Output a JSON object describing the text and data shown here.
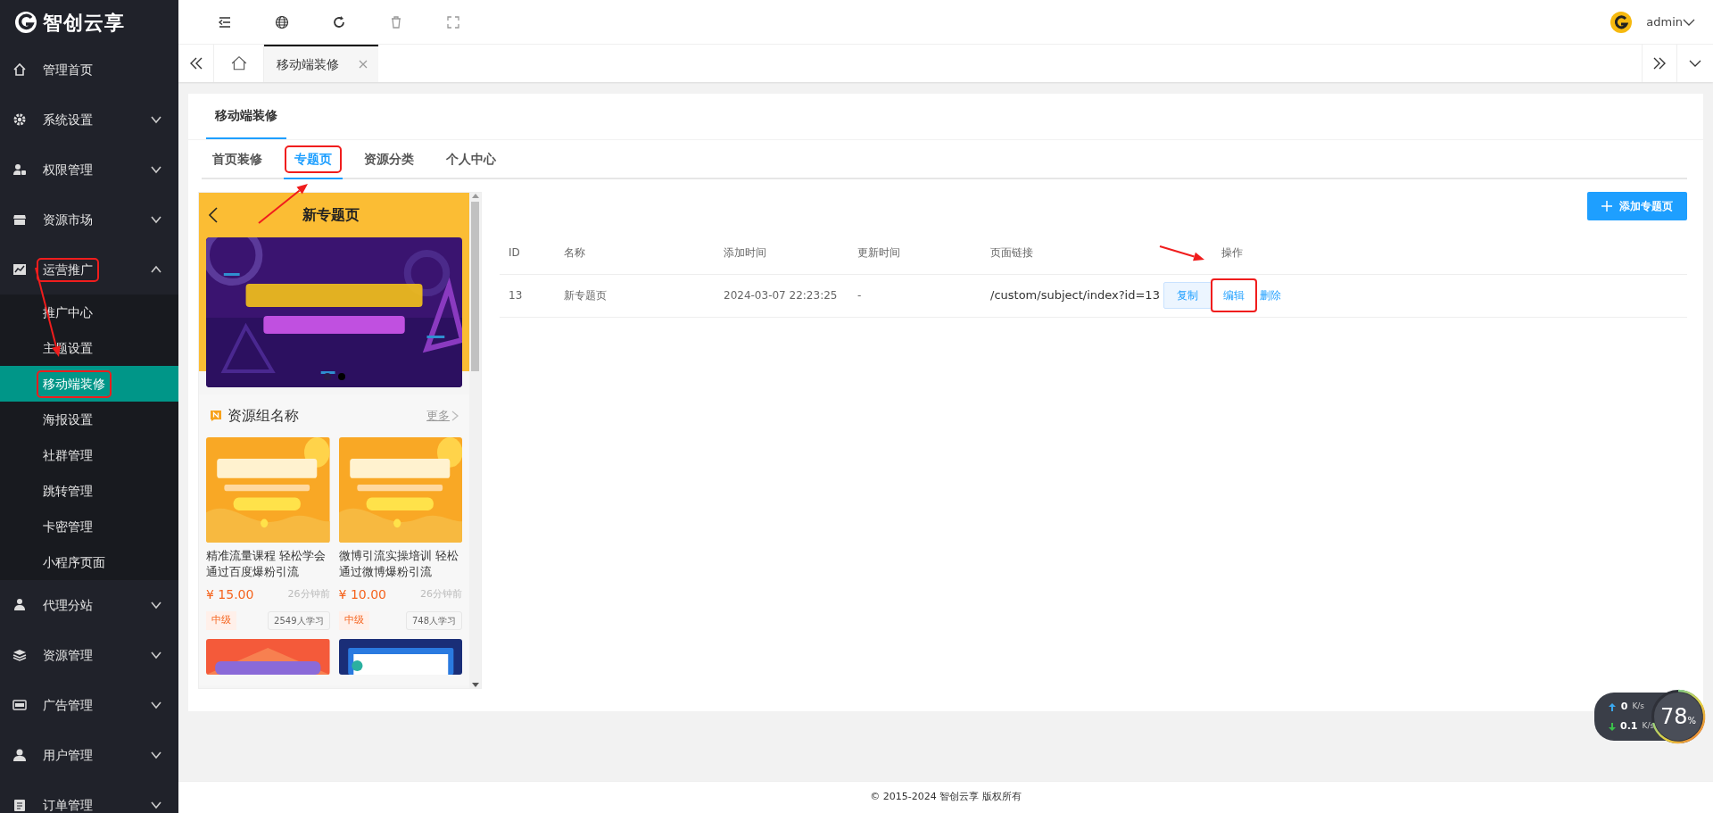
{
  "sidebar": {
    "logo": "智创云享",
    "items": [
      {
        "label": "管理首页",
        "highlighted": false
      },
      {
        "label": "系统设置",
        "expanded": false,
        "highlighted": false
      },
      {
        "label": "权限管理",
        "expanded": false,
        "highlighted": false
      },
      {
        "label": "资源市场",
        "expanded": false,
        "highlighted": false
      },
      {
        "label": "运营推广",
        "expanded": true,
        "highlighted": true,
        "children": [
          {
            "label": "推广中心",
            "selected": false,
            "highlighted": false
          },
          {
            "label": "主题设置",
            "selected": false,
            "highlighted": false
          },
          {
            "label": "移动端装修",
            "selected": true,
            "highlighted": true
          },
          {
            "label": "海报设置",
            "selected": false,
            "highlighted": false
          },
          {
            "label": "社群管理",
            "selected": false,
            "highlighted": false
          },
          {
            "label": "跳转管理",
            "selected": false,
            "highlighted": false
          },
          {
            "label": "卡密管理",
            "selected": false,
            "highlighted": false
          },
          {
            "label": "小程序页面",
            "selected": false,
            "highlighted": false
          }
        ]
      },
      {
        "label": "代理分站",
        "expanded": false,
        "highlighted": false
      },
      {
        "label": "资源管理",
        "expanded": false,
        "highlighted": false
      },
      {
        "label": "广告管理",
        "expanded": false,
        "highlighted": false
      },
      {
        "label": "用户管理",
        "expanded": false,
        "highlighted": false
      },
      {
        "label": "订单管理",
        "expanded": false,
        "highlighted": false
      }
    ]
  },
  "header": {
    "user": "admin"
  },
  "page_tabs": [
    {
      "label": "移动端装修",
      "selected": true
    }
  ],
  "card": {
    "title_tabs": [
      {
        "label": "移动端装修",
        "selected": true
      }
    ],
    "tabs": [
      {
        "label": "首页装修",
        "selected": false,
        "highlighted": false
      },
      {
        "label": "专题页",
        "selected": true,
        "highlighted": true
      },
      {
        "label": "资源分类",
        "selected": false,
        "highlighted": false
      },
      {
        "label": "个人中心",
        "selected": false,
        "highlighted": false
      }
    ]
  },
  "preview": {
    "title": "新专题页",
    "carousel_dots": [
      {
        "selected": false
      },
      {
        "selected": true
      }
    ],
    "section_title": "资源组名称",
    "more": "更多",
    "courses": [
      {
        "title": "精准流量课程 轻松学会通过百度爆粉引流",
        "price": "¥ 15.00",
        "time": "26分钟前",
        "level_tag": "中级",
        "learners": "2549人学习"
      },
      {
        "title": "微博引流实操培训 轻松通过微博爆粉引流",
        "price": "¥ 10.00",
        "time": "26分钟前",
        "level_tag": "中级",
        "learners": "748人学习"
      }
    ]
  },
  "add_button": "添加专题页",
  "table": {
    "columns": [
      "ID",
      "名称",
      "添加时间",
      "更新时间",
      "页面链接",
      "操作"
    ],
    "rows": [
      {
        "id": "13",
        "name": "新专题页",
        "added": "2024-03-07 22:23:25",
        "updated": "-",
        "link": "/custom/subject/index?id=13",
        "copy": "复制",
        "actions": [
          {
            "label": "编辑",
            "highlighted": true
          },
          {
            "label": "删除",
            "highlighted": false
          }
        ]
      }
    ]
  },
  "footer": "© 2015-2024 智创云享 版权所有",
  "net_widget": {
    "up": "0",
    "up_unit": "K/s",
    "down": "0.1",
    "down_unit": "K/s",
    "percent": "78",
    "percent_unit": "%"
  },
  "annotation_arrows": [
    {
      "kind": "arrow"
    },
    {
      "kind": "arrow"
    },
    {
      "kind": "arrow"
    }
  ]
}
